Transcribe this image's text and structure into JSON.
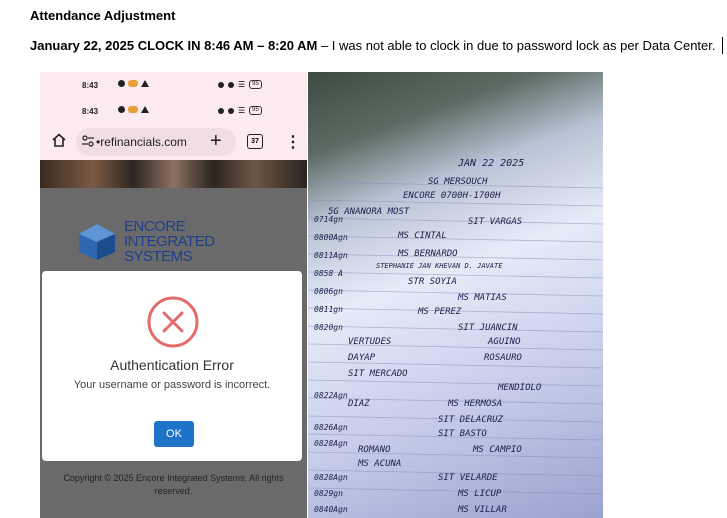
{
  "document": {
    "title": "Attendance Adjustment",
    "entry_date_time": "January 22, 2025 CLOCK IN 8:46 AM – 8:20 AM",
    "entry_reason": " – I was not able to clock in due to password lock as per Data Center."
  },
  "phone": {
    "status_time": "8:43",
    "battery": "95",
    "url": "•refinancials.com",
    "tab_count": "37",
    "logo_lines": [
      "ENCORE",
      "INTEGRATED",
      "SYSTEMS"
    ],
    "dialog": {
      "title": "Authentication Error",
      "message": "Your username or password is incorrect.",
      "ok_label": "OK"
    },
    "copyright": "Copyright © 2025 Encore Integrated Systems. All rights reserved."
  },
  "sheet": {
    "header_date": "JAN 22 2025",
    "header_lines": [
      "SG MERSOUCH",
      "ENCORE 0700H-1700H"
    ],
    "entries": [
      "5G ANANORA MOST",
      "SIT VARGAS",
      "MS CINTAL",
      "MS BERNARDO",
      "STEPHANIE JAN KHEVAN D. JAVATE",
      "STR SOYIA",
      "MS MATIAS",
      "MS PEREZ",
      "SIT JUANCIN",
      "VERTUDES",
      "AGUINO",
      "DAYAP",
      "ROSAURO",
      "SIT MERCADO",
      "MENDIOLO",
      "DIAZ",
      "MS HERMOSA",
      "SIT DELACRUZ",
      "SIT BASTO",
      "ROMANO",
      "MS CAMPIO",
      "MS ACUNA",
      "SIT VELARDE",
      "MS LICUP",
      "MS VILLAR"
    ]
  }
}
